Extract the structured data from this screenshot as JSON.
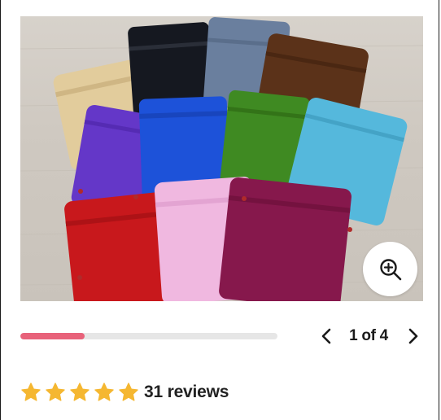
{
  "gallery": {
    "image_alt": "Velvet drawstring pouches in assorted colors",
    "counter": "1 of 4",
    "progress_fraction": 0.25,
    "progress_color": "#e8627a",
    "zoom_icon": "zoom-in-icon",
    "prev_icon": "chevron-left-icon",
    "next_icon": "chevron-right-icon"
  },
  "rating": {
    "stars": 5,
    "star_color": "#f5b731",
    "reviews_label": "31 reviews"
  }
}
